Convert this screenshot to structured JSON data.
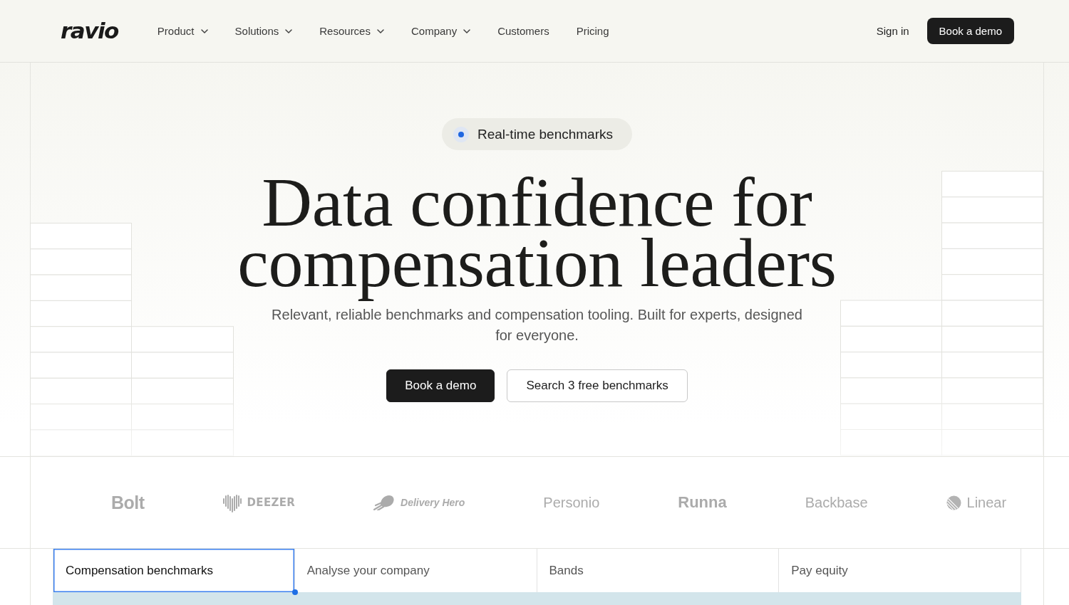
{
  "header": {
    "logo": "ravio",
    "nav": [
      {
        "label": "Product",
        "dropdown": true
      },
      {
        "label": "Solutions",
        "dropdown": true
      },
      {
        "label": "Resources",
        "dropdown": true
      },
      {
        "label": "Company",
        "dropdown": true
      },
      {
        "label": "Customers",
        "dropdown": false
      },
      {
        "label": "Pricing",
        "dropdown": false
      }
    ],
    "sign_in": "Sign in",
    "cta": "Book a demo"
  },
  "hero": {
    "badge": "Real-time benchmarks",
    "title": "Data confidence for compensation leaders",
    "subtitle": "Relevant, reliable benchmarks and compensation tooling. Built for experts, designed for everyone.",
    "buttons": [
      {
        "label": "Book a demo",
        "kind": "primary"
      },
      {
        "label": "Search 3 free benchmarks",
        "kind": "secondary"
      }
    ]
  },
  "logos": [
    {
      "name": "Bolt",
      "kind": "bold"
    },
    {
      "name": "DEEZER",
      "kind": "heart"
    },
    {
      "name": "Delivery Hero",
      "kind": "comet"
    },
    {
      "name": "Personio",
      "kind": "plain"
    },
    {
      "name": "Runna",
      "kind": "heavy"
    },
    {
      "name": "Backbase",
      "kind": "plain"
    },
    {
      "name": "Linear",
      "kind": "disc"
    }
  ],
  "tabs": [
    {
      "label": "Compensation benchmarks",
      "selected": true
    },
    {
      "label": "Analyse your company",
      "selected": false
    },
    {
      "label": "Bands",
      "selected": false
    },
    {
      "label": "Pay equity",
      "selected": false
    }
  ]
}
